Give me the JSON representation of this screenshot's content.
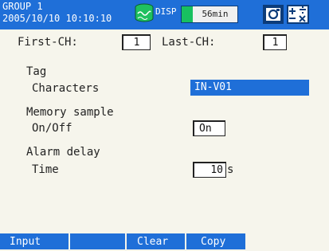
{
  "header": {
    "group": "GROUP 1",
    "datetime": "2005/10/10 10:10:10",
    "disp_label": "DISP",
    "rate": "56min",
    "status_icon": "recording-drum-icon",
    "mode_icon": "camera-icon",
    "math_icon": "math-operators-icon"
  },
  "channels": {
    "first_label": "First-CH:",
    "first_value": "1",
    "last_label": "Last-CH:",
    "last_value": "1"
  },
  "tag": {
    "section": "Tag",
    "label": "Characters",
    "value": "IN-V01"
  },
  "memory_sample": {
    "section": "Memory sample",
    "label": "On/Off",
    "value": "On"
  },
  "alarm_delay": {
    "section": "Alarm delay",
    "label": "Time",
    "value": "10",
    "unit": "s"
  },
  "softkeys": [
    "Input",
    "",
    "Clear",
    "Copy"
  ],
  "colors": {
    "header_bg": "#1f6fd8",
    "body_bg": "#f6f5ec",
    "rate_indicator": "#18c060"
  }
}
